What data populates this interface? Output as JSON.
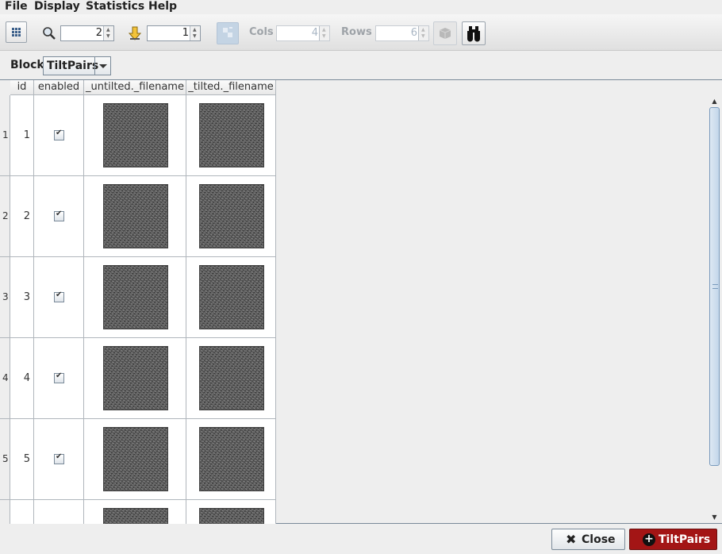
{
  "menubar": {
    "items": [
      "File",
      "Display",
      "Statistics",
      "Help"
    ]
  },
  "toolbar": {
    "grid_icon": "grid-view-icon",
    "zoom_icon": "magnifier-icon",
    "zoom_value": "2",
    "goto_icon": "goto-down-arrow-icon",
    "goto_value": "1",
    "normalize_icon": "normalize-icon",
    "cols_label": "Cols",
    "cols_value": "4",
    "rows_label": "Rows",
    "rows_value": "6",
    "render3d_icon": "cube-icon",
    "find_icon": "binoculars-icon"
  },
  "block": {
    "label": "Block",
    "selected": "TiltPairs"
  },
  "table": {
    "columns": [
      "id",
      "enabled",
      "_untilted._filename",
      "_tilted._filename"
    ],
    "rows": [
      {
        "row": "1",
        "id": "1",
        "enabled": true
      },
      {
        "row": "2",
        "id": "2",
        "enabled": true
      },
      {
        "row": "3",
        "id": "3",
        "enabled": true
      },
      {
        "row": "4",
        "id": "4",
        "enabled": true
      },
      {
        "row": "5",
        "id": "5",
        "enabled": true
      },
      {
        "row": "",
        "id": "",
        "enabled": false
      }
    ]
  },
  "buttons": {
    "close_label": "Close",
    "close_icon": "close-x-icon",
    "tiltpairs_label": "TiltPairs",
    "tiltpairs_icon": "plus-circle-icon"
  },
  "colors": {
    "accent_red": "#a31515",
    "scroll_blue": "#c3d6ea"
  }
}
